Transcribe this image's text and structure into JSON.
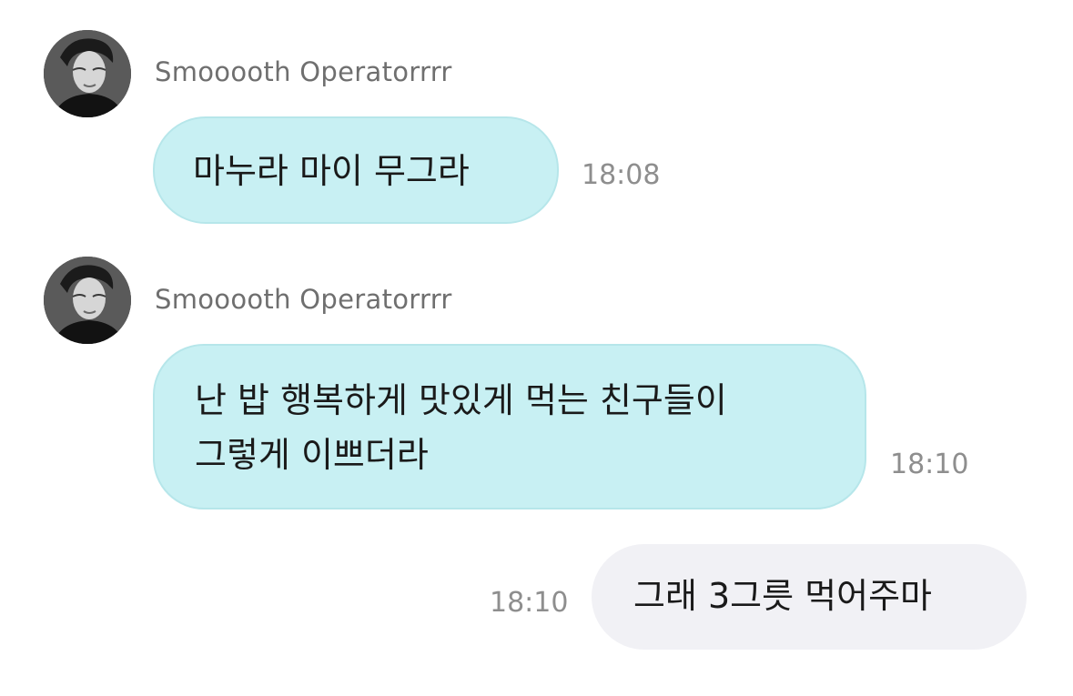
{
  "messages": [
    {
      "sender": "Smooooth Operatorrrr",
      "lines": [
        "마누라 마이 무그라"
      ],
      "time": "18:08",
      "direction": "incoming",
      "avatar_icon": "person-portrait-icon"
    },
    {
      "sender": "Smooooth Operatorrrr",
      "lines": [
        "난 밥 행복하게 맛있게 먹는 친구들이",
        "그렇게 이쁘더라"
      ],
      "time": "18:10",
      "direction": "incoming",
      "avatar_icon": "person-portrait-icon"
    },
    {
      "lines": [
        "그래 3그릇 먹어주마"
      ],
      "time": "18:10",
      "direction": "outgoing"
    }
  ],
  "colors": {
    "incoming_bubble": "#c8f0f3",
    "outgoing_bubble": "#f1f1f5",
    "sender_name": "#6f6f6f",
    "timestamp": "#8e8e8e",
    "message_text": "#1a1a1a"
  }
}
